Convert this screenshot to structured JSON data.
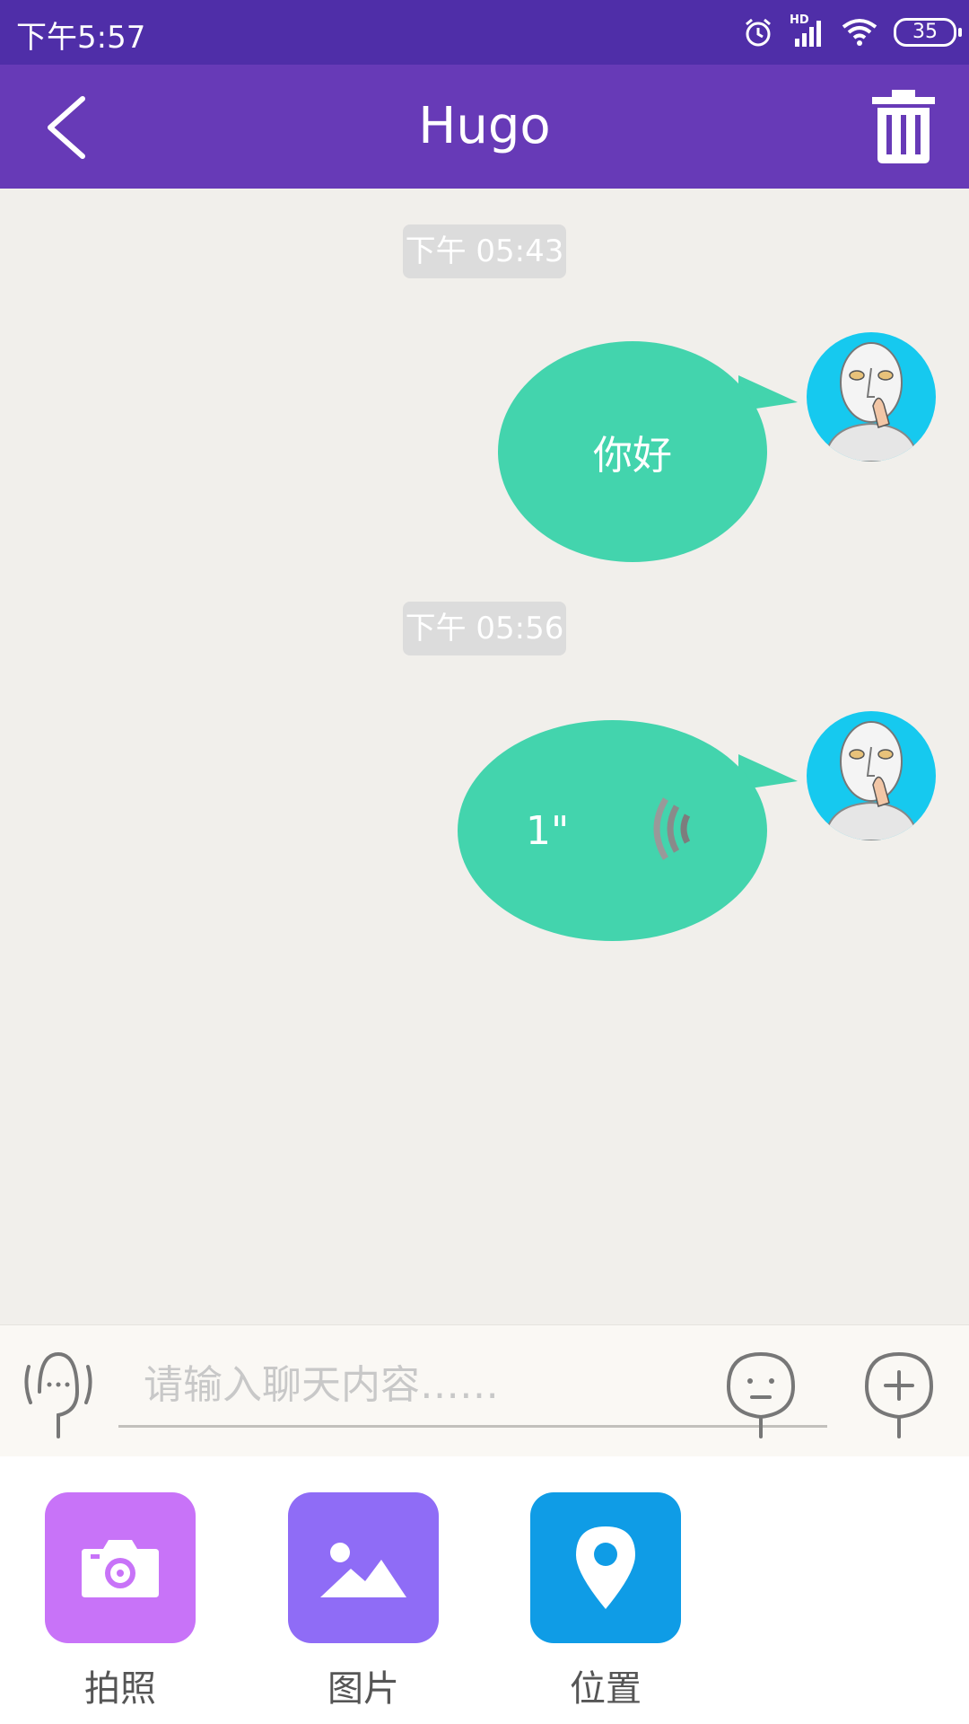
{
  "status_bar": {
    "time": "下午5:57",
    "hd_badge": "HD",
    "battery": "35"
  },
  "header": {
    "title": "Hugo",
    "back_icon": "chevron-left-icon",
    "trash_icon": "trash-icon"
  },
  "messages": [
    {
      "timestamp": "下午 05:43",
      "type": "text",
      "text": "你好",
      "sender": "self"
    },
    {
      "timestamp": "下午 05:56",
      "type": "voice",
      "duration": "1\"",
      "sender": "self"
    }
  ],
  "input_bar": {
    "placeholder": "请输入聊天内容……"
  },
  "tools": [
    {
      "label": "拍照",
      "icon": "camera-icon",
      "color": "#c873f8"
    },
    {
      "label": "图片",
      "icon": "image-icon",
      "color": "#8f6cf6"
    },
    {
      "label": "位置",
      "icon": "location-pin-icon",
      "color": "#0f9ce6"
    }
  ],
  "colors": {
    "status_bar": "#4f2ea8",
    "header": "#673ab7",
    "bubble": "#43d4ad",
    "avatar_bg": "#16c9ef"
  }
}
